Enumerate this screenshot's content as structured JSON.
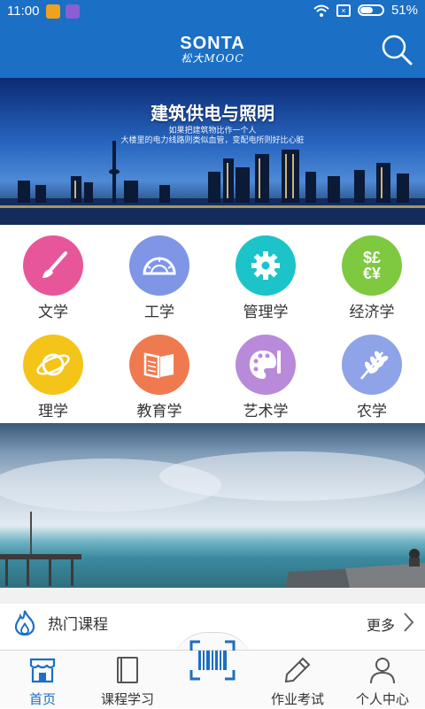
{
  "status_bar": {
    "time": "11:00",
    "battery": "51%"
  },
  "header": {
    "logo_line1": "SONTA",
    "logo_line2": "松大MOOC",
    "search_icon": "search-icon"
  },
  "banner": {
    "title": "建筑供电与照明",
    "subtitle_line1": "如果把建筑物比作一个人",
    "subtitle_line2": "大楼里的电力线路则类似血管，变配电所则好比心脏"
  },
  "categories": [
    {
      "label": "文学",
      "icon": "brush-icon",
      "color": "#e8569a"
    },
    {
      "label": "工学",
      "icon": "protractor-icon",
      "color": "#7f95e6"
    },
    {
      "label": "管理学",
      "icon": "gear-icon",
      "color": "#1cc3c9"
    },
    {
      "label": "经济学",
      "icon": "currency-icon",
      "color": "#7ec940"
    },
    {
      "label": "理学",
      "icon": "planet-icon",
      "color": "#f5c419"
    },
    {
      "label": "教育学",
      "icon": "book-icon",
      "color": "#f07a50"
    },
    {
      "label": "艺术学",
      "icon": "palette-icon",
      "color": "#b98ad9"
    },
    {
      "label": "农学",
      "icon": "wheat-icon",
      "color": "#8fa3e8"
    }
  ],
  "hot_courses": {
    "title": "热门课程",
    "more": "更多"
  },
  "tabbar": [
    {
      "label": "首页",
      "icon": "home-store-icon",
      "active": true
    },
    {
      "label": "课程学习",
      "icon": "book-course-icon",
      "active": false
    },
    {
      "label": "",
      "icon": "barcode-scan-icon",
      "active": false
    },
    {
      "label": "作业考试",
      "icon": "pencil-icon",
      "active": false
    },
    {
      "label": "个人中心",
      "icon": "person-icon",
      "active": false
    }
  ],
  "colors": {
    "brand": "#1b6fc4"
  }
}
